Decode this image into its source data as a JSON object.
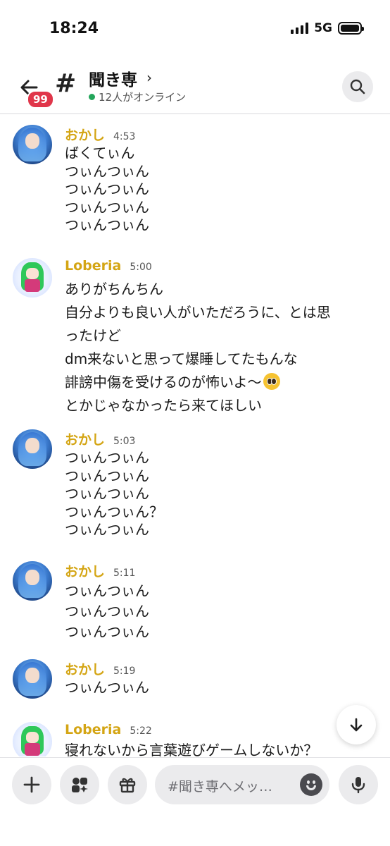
{
  "status_bar": {
    "time": "18:24",
    "network": "5G",
    "signal_bars": 4,
    "battery_level": 1.0
  },
  "header": {
    "back_icon": "arrow-left-icon",
    "unread_badge": "99",
    "channel_icon": "hash-icon",
    "channel_name": "聞き専",
    "chevron": "›",
    "online_text": "12人がオンライン",
    "online_color": "#23a55a",
    "search_icon": "search-icon"
  },
  "messages": [
    {
      "author": "おかし",
      "time": "4:53",
      "avatar": "okashi-avatar",
      "lines": [
        "ばくてぃん",
        "つぃんつぃん",
        "つぃんつぃん",
        "つぃんつぃん",
        "つぃんつぃん"
      ]
    },
    {
      "author": "Loberia",
      "time": "5:00",
      "avatar": "loberia-avatar",
      "lines": [
        "ありがちんちん",
        "自分よりも良い人がいただろうに、とは思",
        "ったけど",
        "dm来ないと思って爆睡してたもんな",
        "誹謗中傷を受けるのが怖いよ〜",
        "とかじゃなかったら来てほしい"
      ],
      "emoji_after_line": 4,
      "emoji_name": "pleading-face-emoji"
    },
    {
      "author": "おかし",
      "time": "5:03",
      "avatar": "okashi-avatar",
      "lines": [
        "つぃんつぃん",
        "つぃんつぃん",
        "つぃんつぃん",
        "つぃんつぃん？",
        "つぃんつぃん"
      ]
    },
    {
      "author": "おかし",
      "time": "5:11",
      "avatar": "okashi-avatar",
      "lines": [
        "つぃんつぃん",
        "つぃんつぃん",
        "つぃんつぃん"
      ]
    },
    {
      "author": "おかし",
      "time": "5:19",
      "avatar": "okashi-avatar",
      "lines": [
        "つぃんつぃん"
      ]
    },
    {
      "author": "Loberia",
      "time": "5:22",
      "avatar": "loberia-avatar",
      "lines": [
        "寝れないから言葉遊びゲームしないか？"
      ]
    }
  ],
  "author_color": "#d4a514",
  "scroll_down_icon": "arrow-down-icon",
  "composer": {
    "plus_icon": "plus-icon",
    "apps_icon": "apps-icon",
    "gift_icon": "gift-icon",
    "placeholder": "#聞き専へメッ…",
    "emoji_icon": "emoji-icon",
    "mic_icon": "microphone-icon"
  }
}
